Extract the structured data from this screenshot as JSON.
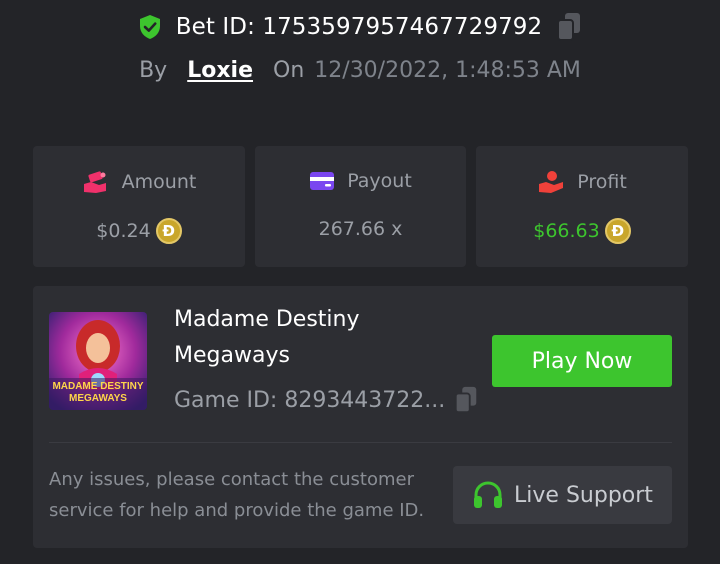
{
  "bet": {
    "id_label": "Bet ID: 1753597957467729792",
    "by_label": "By",
    "user": "Loxie",
    "on_label": "On",
    "datetime": "12/30/2022, 1:48:53 AM"
  },
  "stats": {
    "amount": {
      "label": "Amount",
      "value": "$0.24",
      "currency_symbol": "Ð"
    },
    "payout": {
      "label": "Payout",
      "value": "267.66 x"
    },
    "profit": {
      "label": "Profit",
      "value": "$66.63",
      "currency_symbol": "Ð"
    }
  },
  "game": {
    "name_line1": "Madame Destiny",
    "name_line2": "Megaways",
    "id_label": "Game ID: 8293443722...",
    "thumb_text_line1": "MADAME DESTINY",
    "thumb_text_line2": "MEGAWAYS",
    "play_label": "Play Now"
  },
  "support": {
    "message": "Any issues, please contact the customer service for help and provide the game ID.",
    "button_label": "Live Support"
  },
  "colors": {
    "background": "#232428",
    "card": "#2d2e33",
    "accent_green": "#3dc52e",
    "muted_text": "#9b9fa6",
    "coin_gold": "#c9a62b"
  },
  "icons": {
    "verified": "shield-check-icon",
    "copy": "copy-icon",
    "amount": "hand-money-icon",
    "payout": "credit-card-icon",
    "profit": "hand-coin-icon",
    "support": "headset-icon",
    "currency": "dogecoin-icon"
  }
}
